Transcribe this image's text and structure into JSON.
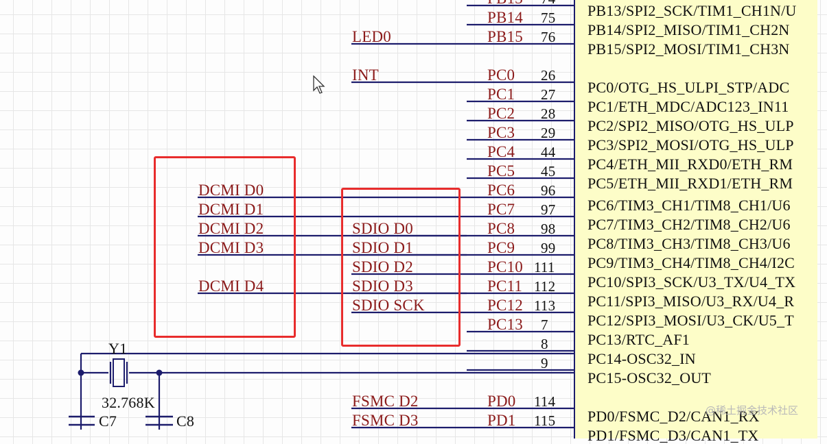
{
  "pins": [
    {
      "name": "PB13",
      "num": "74",
      "func": "PB13/SPI2_SCK/TIM1_CH1N/U",
      "net": ""
    },
    {
      "name": "PB14",
      "num": "75",
      "func": "PB14/SPI2_MISO/TIM1_CH2N",
      "net": ""
    },
    {
      "name": "PB15",
      "num": "76",
      "func": "PB15/SPI2_MOSI/TIM1_CH3N",
      "net": "LED0"
    },
    {
      "name": "PC0",
      "num": "26",
      "func": "PC0/OTG_HS_ULPI_STP/ADC",
      "net": "INT"
    },
    {
      "name": "PC1",
      "num": "27",
      "func": "PC1/ETH_MDC/ADC123_IN11",
      "net": ""
    },
    {
      "name": "PC2",
      "num": "28",
      "func": "PC2/SPI2_MISO/OTG_HS_ULP",
      "net": ""
    },
    {
      "name": "PC3",
      "num": "29",
      "func": "PC3/SPI2_MOSI/OTG_HS_ULP",
      "net": ""
    },
    {
      "name": "PC4",
      "num": "44",
      "func": "PC4/ETH_MII_RXD0/ETH_RM",
      "net": ""
    },
    {
      "name": "PC5",
      "num": "45",
      "func": "PC5/ETH_MII_RXD1/ETH_RM",
      "net": ""
    },
    {
      "name": "PC6",
      "num": "96",
      "func": "PC6/TIM3_CH1/TIM8_CH1/U6",
      "net": "DCMI_D0"
    },
    {
      "name": "PC7",
      "num": "97",
      "func": "PC7/TIM3_CH2/TIM8_CH2/U6",
      "net": "DCMI_D1"
    },
    {
      "name": "PC8",
      "num": "98",
      "func": "PC8/TIM3_CH3/TIM8_CH3/U6",
      "net": "SDIO_D0"
    },
    {
      "name": "PC9",
      "num": "99",
      "func": "PC9/TIM3_CH4/TIM8_CH4/I2C",
      "net": "SDIO_D1"
    },
    {
      "name": "PC10",
      "num": "111",
      "func": "PC10/SPI3_SCK/U3_TX/U4_TX",
      "net": "SDIO_D2"
    },
    {
      "name": "PC11",
      "num": "112",
      "func": "PC11/SPI3_MISO/U3_RX/U4_R",
      "net": "SDIO_D3"
    },
    {
      "name": "PC12",
      "num": "113",
      "func": "PC12/SPI3_MOSI/U3_CK/U5_T",
      "net": "SDIO_SCK"
    },
    {
      "name": "PC13",
      "num": "7",
      "func": "PC13/RTC_AF1",
      "net": ""
    },
    {
      "name": "",
      "num": "8",
      "func": "PC14-OSC32_IN",
      "net": ""
    },
    {
      "name": "",
      "num": "9",
      "func": "PC15-OSC32_OUT",
      "net": ""
    },
    {
      "name": "PD0",
      "num": "114",
      "func": "PD0/FSMC_D2/CAN1_RX",
      "net": "FSMC_D2"
    },
    {
      "name": "PD1",
      "num": "115",
      "func": "PD1/FSMC_D3/CAN1_TX",
      "net": "FSMC_D3"
    }
  ],
  "dcmi_labels": [
    {
      "text": "DCMI_D0",
      "pin": "PC6"
    },
    {
      "text": "DCMI_D1",
      "pin": "PC7"
    },
    {
      "text": "DCMI_D2",
      "pin": "PC8"
    },
    {
      "text": "DCMI_D3",
      "pin": "PC9"
    },
    {
      "text": "DCMI_D4",
      "pin": "PC11"
    }
  ],
  "crystal": {
    "ref": "Y1",
    "value": "32.768K",
    "caps": [
      "C7",
      "C8"
    ]
  },
  "watermark": "@稀土掘金技术社区",
  "colors": {
    "wire": "#1c1c6c",
    "net_label": "#8b1a1a",
    "highlight": "#e82c2c",
    "chip_fill": "#fdfdc8"
  }
}
